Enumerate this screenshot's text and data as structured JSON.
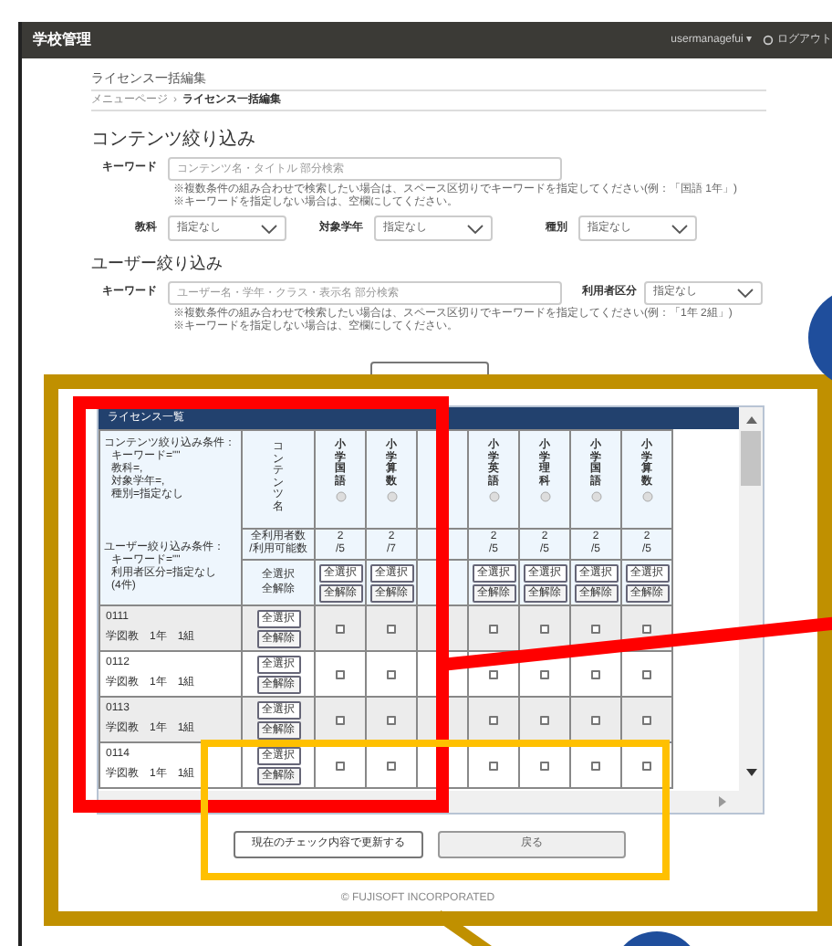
{
  "header": {
    "title": "学校管理",
    "user_menu": "usermanagefui ▾",
    "logout": "ログアウト"
  },
  "page_title": "ライセンス一括編集",
  "breadcrumb": [
    {
      "label": "メニューページ"
    },
    {
      "separator": "›",
      "label": "ライセンス一括編集"
    }
  ],
  "content_filter": {
    "heading": "コンテンツ絞り込み",
    "keyword_label": "キーワード",
    "keyword_placeholder": "コンテンツ名・タイトル 部分検索",
    "notes": [
      "※複数条件の組み合わせで検索したい場合は、スペース区切りでキーワードを指定してください(例：「国語 1年」)",
      "※キーワードを指定しない場合は、空欄にしてください。"
    ],
    "selects": [
      {
        "label": "教科",
        "value": "指定なし"
      },
      {
        "label": "対象学年",
        "value": "指定なし"
      },
      {
        "label": "種別",
        "value": "指定なし"
      }
    ]
  },
  "user_filter": {
    "heading": "ユーザー絞り込み",
    "keyword_label": "キーワード",
    "keyword_placeholder": "ユーザー名・学年・クラス・表示名 部分検索",
    "type_label": "利用者区分",
    "type_value": "指定なし",
    "notes": [
      "※複数条件の組み合わせで検索したい場合は、スペース区切りでキーワードを指定してください(例：「1年 2組」)",
      "※キーワードを指定しない場合は、空欄にしてください。"
    ]
  },
  "license_table": {
    "title": "ライセンス一覧",
    "content_conditions": [
      "コンテンツ絞り込み条件：",
      "キーワード=\"\"",
      "教科=,",
      "対象学年=,",
      "種別=指定なし"
    ],
    "user_conditions": [
      "ユーザー絞り込み条件：",
      "キーワード=\"\"",
      "利用者区分=指定なし",
      "(4件)"
    ],
    "content_name_header": "コンテンツ名",
    "count_label": [
      "全利用者数",
      "/利用可能数"
    ],
    "bulk_labels": [
      "全選択",
      "全解除"
    ],
    "columns": [
      {
        "name": "小学国語",
        "count": [
          "2",
          "/5"
        ],
        "select_all": "全選択",
        "clear_all": "全解除"
      },
      {
        "name": "小学算数",
        "count": [
          "2",
          "/7"
        ],
        "select_all": "全選択",
        "clear_all": "全解除"
      },
      {},
      {
        "name": "小学英語",
        "count": [
          "2",
          "/5"
        ],
        "select_all": "全選択",
        "clear_all": "全解除"
      },
      {
        "name": "小学理科",
        "count": [
          "2",
          "/5"
        ],
        "select_all": "全選択",
        "clear_all": "全解除"
      },
      {
        "name": "小学国語",
        "count": [
          "2",
          "/5"
        ],
        "select_all": "全選択",
        "clear_all": "全解除"
      },
      {
        "name": "小学算数",
        "count": [
          "2",
          "/5"
        ],
        "select_all": "全選択",
        "clear_all": "全解除"
      }
    ],
    "rows": [
      {
        "id": "0111",
        "user": "学図教　1年　1組",
        "select_all": "全選択",
        "clear_all": "全解除",
        "cells": [
          {
            "checked": false
          },
          {
            "checked": false
          },
          {},
          {
            "checked": false
          },
          {
            "checked": false
          },
          {
            "checked": false
          },
          {
            "checked": false
          }
        ]
      },
      {
        "id": "0112",
        "user": "学図教　1年　1組",
        "select_all": "全選択",
        "clear_all": "全解除",
        "cells": [
          {
            "checked": false
          },
          {
            "checked": false
          },
          {},
          {
            "checked": false
          },
          {
            "checked": false
          },
          {
            "checked": false
          },
          {
            "checked": false
          }
        ]
      },
      {
        "id": "0113",
        "user": "学図教　1年　1組",
        "select_all": "全選択",
        "clear_all": "全解除",
        "cells": [
          {
            "checked": false
          },
          {
            "checked": false
          },
          {},
          {
            "checked": false
          },
          {
            "checked": false
          },
          {
            "checked": false
          },
          {
            "checked": false
          }
        ]
      },
      {
        "id": "0114",
        "user": "学図教　1年　1組",
        "select_all": "全選択",
        "clear_all": "全解除",
        "cells": [
          {
            "checked": false
          },
          {
            "checked": false
          },
          {},
          {
            "checked": false
          },
          {
            "checked": false
          },
          {
            "checked": false
          },
          {
            "checked": false
          }
        ]
      }
    ]
  },
  "buttons": [
    {
      "label": "現在のチェック内容で更新する",
      "kind": "primary"
    },
    {
      "label": "戻る",
      "kind": "secondary"
    }
  ],
  "footer": "© FUJISOFT INCORPORATED",
  "annotations": [
    {
      "kind": "frame",
      "color": "#c09000"
    },
    {
      "kind": "frame",
      "color": "#ff0000"
    },
    {
      "kind": "frame",
      "color": "#ffc000"
    },
    {
      "kind": "line",
      "color": "#ff0000"
    },
    {
      "kind": "line",
      "color": "#c09000"
    },
    {
      "kind": "circle",
      "color": "#1f4e9c"
    },
    {
      "kind": "circle",
      "color": "#1f4e9c"
    }
  ]
}
